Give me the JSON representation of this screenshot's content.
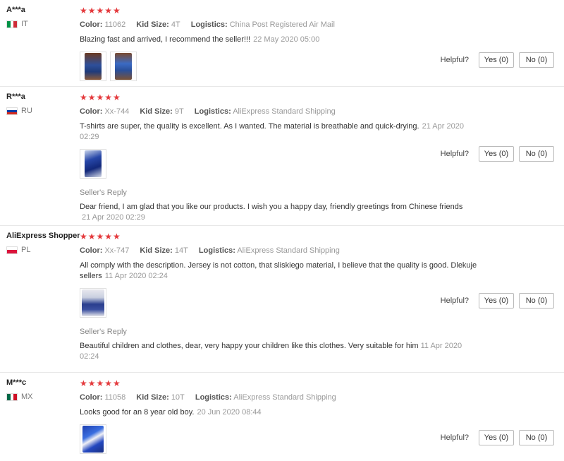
{
  "colors": {
    "star": "#e4393c",
    "muted": "#999999",
    "border": "#e8e8e8"
  },
  "reviews": [
    {
      "user": "A***a",
      "country": "IT",
      "stars": "★★★★★",
      "color_label": "Color:",
      "color": "11062",
      "size_label": "Kid Size:",
      "size": "4T",
      "logistics_label": "Logistics:",
      "logistics": "China Post Registered Air Mail",
      "text": "Blazing fast and arrived, I recommend the seller!!!",
      "date": "22 May 2020 05:00",
      "helpful": "Helpful?",
      "yes": "Yes (0)",
      "no": "No (0)"
    },
    {
      "user": "R***a",
      "country": "RU",
      "stars": "★★★★★",
      "color_label": "Color:",
      "color": "Xx-744",
      "size_label": "Kid Size:",
      "size": "9T",
      "logistics_label": "Logistics:",
      "logistics": "AliExpress Standard Shipping",
      "text": "T-shirts are super, the quality is excellent. As I wanted. The material is breathable and quick-drying.",
      "date": "21 Apr 2020 02:29",
      "reply_heading": "Seller's Reply",
      "reply_text": "Dear friend, I am glad that you like our products. I wish you a happy day, friendly greetings from Chinese friends",
      "reply_date": "21 Apr 2020 02:29",
      "helpful": "Helpful?",
      "yes": "Yes (0)",
      "no": "No (0)"
    },
    {
      "user": "AliExpress Shopper",
      "country": "PL",
      "stars": "★★★★★",
      "color_label": "Color:",
      "color": "Xx-747",
      "size_label": "Kid Size:",
      "size": "14T",
      "logistics_label": "Logistics:",
      "logistics": "AliExpress Standard Shipping",
      "text": "All comply with the description. Jersey is not cotton, that sliskiego material, I believe that the quality is good. Dlekuje sellers",
      "date": "11 Apr 2020 02:24",
      "reply_heading": "Seller's Reply",
      "reply_text": "Beautiful children and clothes, dear, very happy your children like this clothes. Very suitable for him",
      "reply_date": "11 Apr 2020 02:24",
      "helpful": "Helpful?",
      "yes": "Yes (0)",
      "no": "No (0)"
    },
    {
      "user": "M***c",
      "country": "MX",
      "stars": "★★★★★",
      "color_label": "Color:",
      "color": "11058",
      "size_label": "Kid Size:",
      "size": "10T",
      "logistics_label": "Logistics:",
      "logistics": "AliExpress Standard Shipping",
      "text": "Looks good for an 8 year old boy.",
      "date": "20 Jun 2020 08:44",
      "helpful": "Helpful?",
      "yes": "Yes (0)",
      "no": "No (0)"
    }
  ]
}
